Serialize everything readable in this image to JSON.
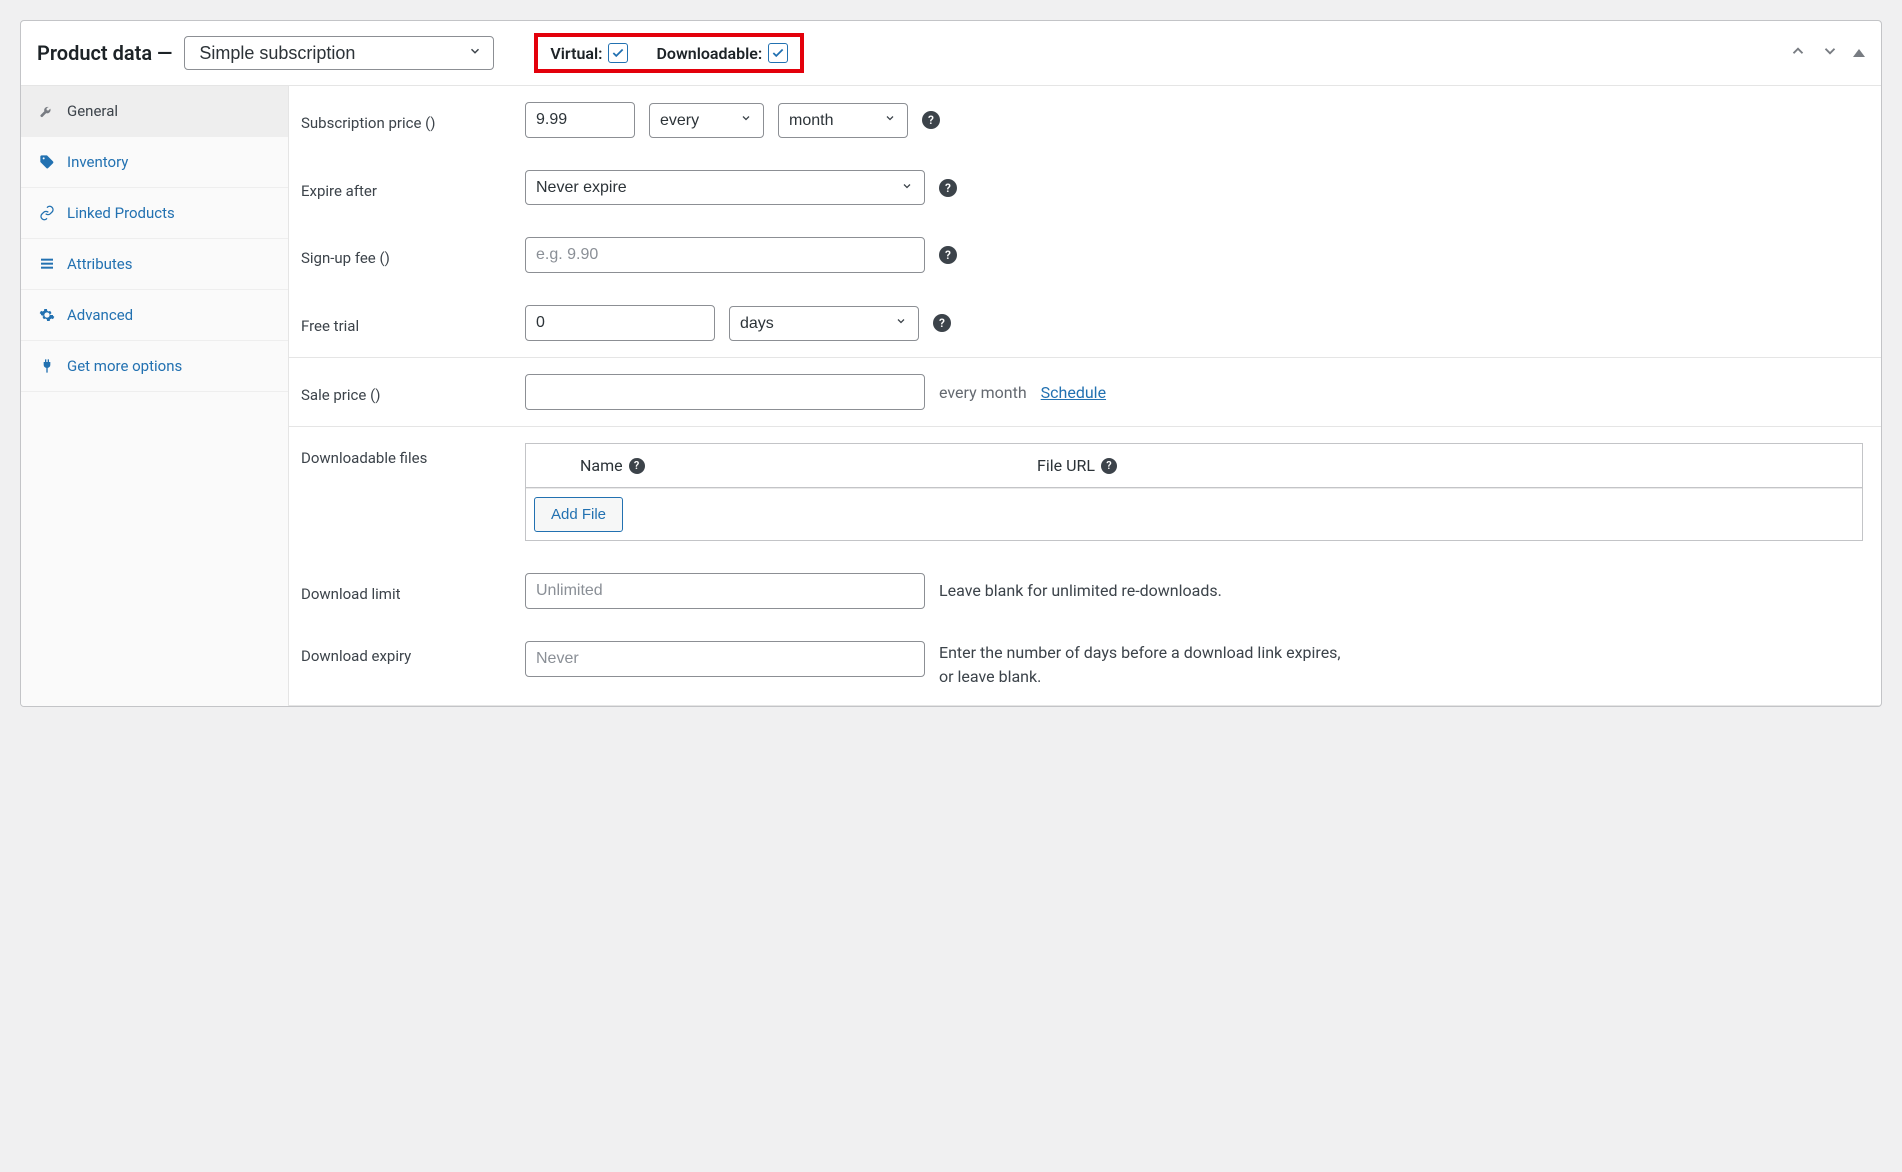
{
  "header": {
    "title": "Product data —",
    "product_type": "Simple subscription",
    "virtual_label": "Virtual:",
    "downloadable_label": "Downloadable:",
    "virtual_checked": true,
    "downloadable_checked": true
  },
  "sidebar": {
    "items": [
      {
        "label": "General",
        "icon": "wrench",
        "active": true
      },
      {
        "label": "Inventory",
        "icon": "tag",
        "active": false
      },
      {
        "label": "Linked Products",
        "icon": "link",
        "active": false
      },
      {
        "label": "Attributes",
        "icon": "list",
        "active": false
      },
      {
        "label": "Advanced",
        "icon": "gear",
        "active": false
      },
      {
        "label": "Get more options",
        "icon": "plug",
        "active": false
      }
    ]
  },
  "form": {
    "subscription_price": {
      "label": "Subscription price ()",
      "value": "9.99",
      "every": "every",
      "period": "month"
    },
    "expire_after": {
      "label": "Expire after",
      "value": "Never expire"
    },
    "signup_fee": {
      "label": "Sign-up fee ()",
      "placeholder": "e.g. 9.90"
    },
    "free_trial": {
      "label": "Free trial",
      "value": "0",
      "unit": "days"
    },
    "sale_price": {
      "label": "Sale price ()",
      "suffix": "every month",
      "schedule_text": "Schedule"
    },
    "downloadable_files": {
      "label": "Downloadable files",
      "col_name": "Name",
      "col_url": "File URL",
      "add_file": "Add File"
    },
    "download_limit": {
      "label": "Download limit",
      "placeholder": "Unlimited",
      "hint": "Leave blank for unlimited re-downloads."
    },
    "download_expiry": {
      "label": "Download expiry",
      "placeholder": "Never",
      "hint": "Enter the number of days before a download link expires, or leave blank."
    }
  }
}
